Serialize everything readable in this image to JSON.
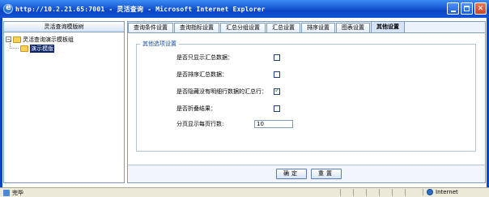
{
  "window": {
    "title": "http://10.2.21.65:7001 - 灵活查询 - Microsoft Internet Explorer",
    "buttons": {
      "minimize": "",
      "maximize": "",
      "close": "✕"
    }
  },
  "sidebar": {
    "header": "灵活查询模版树",
    "tree": [
      {
        "label": "灵活查询演示模板组",
        "expanded": true,
        "toggle": "−"
      },
      {
        "label": "演示模版",
        "selected": true
      }
    ]
  },
  "tabs": [
    {
      "label": "查询条件设置",
      "active": false
    },
    {
      "label": "查询指标设置",
      "active": false
    },
    {
      "label": "汇总分组设置",
      "active": false
    },
    {
      "label": "汇总设置",
      "active": false
    },
    {
      "label": "排序设置",
      "active": false
    },
    {
      "label": "图表设置",
      "active": false
    },
    {
      "label": "其他设置",
      "active": true
    }
  ],
  "panel": {
    "legend": "其他选项设置",
    "options": [
      {
        "label": "是否只显示汇总数据：",
        "checked": false
      },
      {
        "label": "是否排序汇总数据：",
        "checked": false
      },
      {
        "label": "是否隐藏没有明细行数据的汇总行：",
        "checked": true
      },
      {
        "label": "是否折叠结果：",
        "checked": false
      }
    ],
    "page_size": {
      "label": "分页显示每页行数:",
      "value": "10"
    }
  },
  "actions": {
    "confirm": "确定",
    "reset": "重置"
  },
  "statusbar": {
    "text": "完毕",
    "zone": "Internet"
  },
  "colors": {
    "titlebar": "#0a46c4",
    "border": "#7f9db9",
    "selection": "#0a246a"
  }
}
